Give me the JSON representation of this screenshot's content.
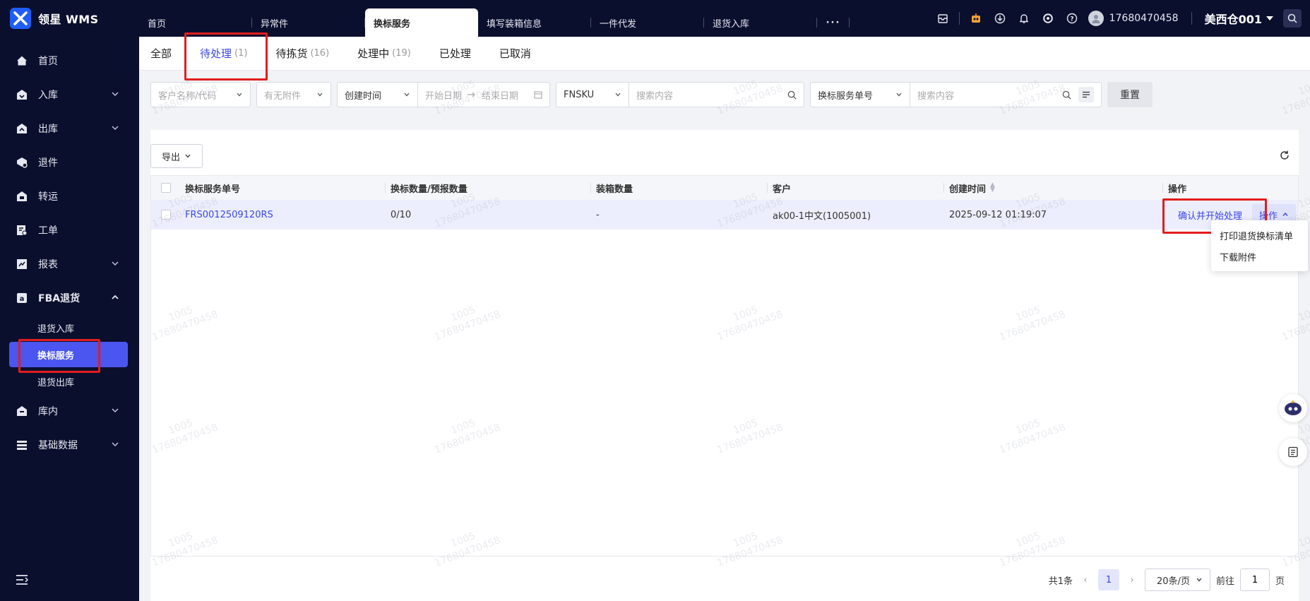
{
  "brand": {
    "name": "领星 WMS"
  },
  "topbar": {
    "tabs": [
      {
        "label": "首页",
        "active": false
      },
      {
        "label": "异常件",
        "active": false
      },
      {
        "label": "换标服务",
        "active": true
      },
      {
        "label": "填写装箱信息",
        "active": false
      },
      {
        "label": "一件代发",
        "active": false
      },
      {
        "label": "退货入库",
        "active": false
      }
    ],
    "more": "···",
    "phone": "17680470458",
    "warehouse": "美西仓001"
  },
  "sidebar": {
    "items": [
      {
        "label": "首页",
        "icon": "home-icon",
        "has_caret": false
      },
      {
        "label": "入库",
        "icon": "inbound-icon",
        "has_caret": true
      },
      {
        "label": "出库",
        "icon": "outbound-icon",
        "has_caret": true
      },
      {
        "label": "退件",
        "icon": "return-icon",
        "has_caret": false
      },
      {
        "label": "转运",
        "icon": "transfer-icon",
        "has_caret": false
      },
      {
        "label": "工单",
        "icon": "ticket-icon",
        "has_caret": false
      },
      {
        "label": "报表",
        "icon": "report-icon",
        "has_caret": true
      },
      {
        "label": "FBA退货",
        "icon": "amazon-icon",
        "has_caret": true,
        "expanded": true
      }
    ],
    "fba_sub": [
      {
        "label": "退货入库",
        "active": false
      },
      {
        "label": "换标服务",
        "active": true
      },
      {
        "label": "退货出库",
        "active": false
      }
    ],
    "items_after": [
      {
        "label": "库内",
        "icon": "warehouse-icon",
        "has_caret": true
      },
      {
        "label": "基础数据",
        "icon": "database-icon",
        "has_caret": true
      }
    ]
  },
  "status_tabs": [
    {
      "label": "全部",
      "count": ""
    },
    {
      "label": "待处理",
      "count": "(1)",
      "active": true
    },
    {
      "label": "待拣货",
      "count": "(16)"
    },
    {
      "label": "处理中",
      "count": "(19)"
    },
    {
      "label": "已处理",
      "count": ""
    },
    {
      "label": "已取消",
      "count": ""
    }
  ],
  "filters": {
    "customer_placeholder": "客户名称/代码",
    "attachment_placeholder": "有无附件",
    "time_type": "创建时间",
    "start_placeholder": "开始日期",
    "end_placeholder": "结束日期",
    "sku_type": "FNSKU",
    "sku_search_placeholder": "搜索内容",
    "order_type": "换标服务单号",
    "order_search_placeholder": "搜索内容",
    "reset_label": "重置"
  },
  "toolbar": {
    "export_label": "导出"
  },
  "table": {
    "columns": [
      "换标服务单号",
      "换标数量/预报数量",
      "装箱数量",
      "客户",
      "创建时间",
      "操作"
    ],
    "rows": [
      {
        "order_no": "FRS0012509120RS",
        "qty": "0/10",
        "box_qty": "-",
        "customer": "ak00-1中文(1005001)",
        "created": "2025-09-12 01:19:07",
        "confirm_action": "确认并开始处理",
        "op_action": "操作"
      }
    ]
  },
  "dropdown": {
    "items": [
      "打印退货换标清单",
      "下载附件"
    ]
  },
  "pager": {
    "total": "共1条",
    "current_page": "1",
    "page_size": "20条/页",
    "goto_label": "前往",
    "goto_value": "1",
    "page_suffix": "页"
  },
  "watermark": {
    "line1": "1005",
    "line2": "17680470458"
  },
  "colors": {
    "sidebar_bg": "#0b0f2e",
    "accent": "#3b46e6",
    "active_menu": "#4a56ef",
    "highlight_box": "#e21d1d"
  }
}
